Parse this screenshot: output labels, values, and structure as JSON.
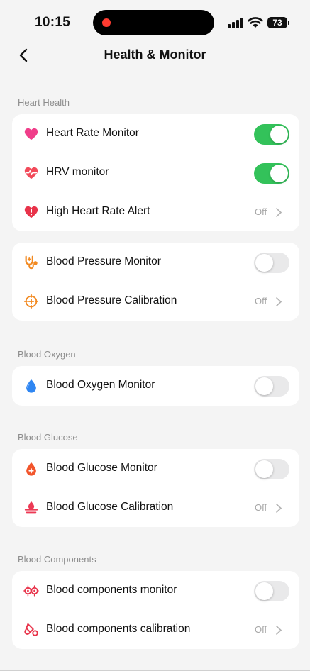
{
  "status_bar": {
    "time": "10:15",
    "battery": "73"
  },
  "header": {
    "title": "Health & Monitor"
  },
  "sections": {
    "heart_health": "Heart Health",
    "blood_oxygen": "Blood Oxygen",
    "blood_glucose": "Blood Glucose",
    "blood_components": "Blood Components"
  },
  "rows": {
    "heart_rate_monitor": {
      "label": "Heart Rate Monitor",
      "toggle": "on",
      "icon": "heart-icon",
      "color": "#f03e8a"
    },
    "hrv_monitor": {
      "label": "HRV monitor",
      "toggle": "on",
      "icon": "heart-pulse-icon",
      "color": "#f24a5a"
    },
    "high_heart_rate_alert": {
      "label": "High Heart Rate Alert",
      "value": "Off",
      "icon": "heart-alert-icon",
      "color": "#e8334a"
    },
    "blood_pressure_monitor": {
      "label": "Blood Pressure Monitor",
      "toggle": "off",
      "icon": "stethoscope-icon",
      "color": "#f28a22"
    },
    "blood_pressure_calibration": {
      "label": "Blood Pressure Calibration",
      "value": "Off",
      "icon": "calibration-icon",
      "color": "#f28a22"
    },
    "blood_oxygen_monitor": {
      "label": "Blood Oxygen Monitor",
      "toggle": "off",
      "icon": "drop-icon",
      "color": "#2f86f2"
    },
    "blood_glucose_monitor": {
      "label": "Blood Glucose Monitor",
      "toggle": "off",
      "icon": "glucose-drop-icon",
      "color": "#f2552c"
    },
    "blood_glucose_calibration": {
      "label": "Blood Glucose Calibration",
      "value": "Off",
      "icon": "glucose-calibration-icon",
      "color": "#ec3a55"
    },
    "blood_components_monitor": {
      "label": "Blood components monitor",
      "toggle": "off",
      "icon": "blood-cells-icon",
      "color": "#e8334a"
    },
    "blood_components_calibration": {
      "label": "Blood components calibration",
      "value": "Off",
      "icon": "test-tube-icon",
      "color": "#e8334a"
    }
  },
  "colors": {
    "toggle_on": "#33c25a",
    "toggle_off": "#e9e9ea",
    "background": "#f4f4f4"
  }
}
